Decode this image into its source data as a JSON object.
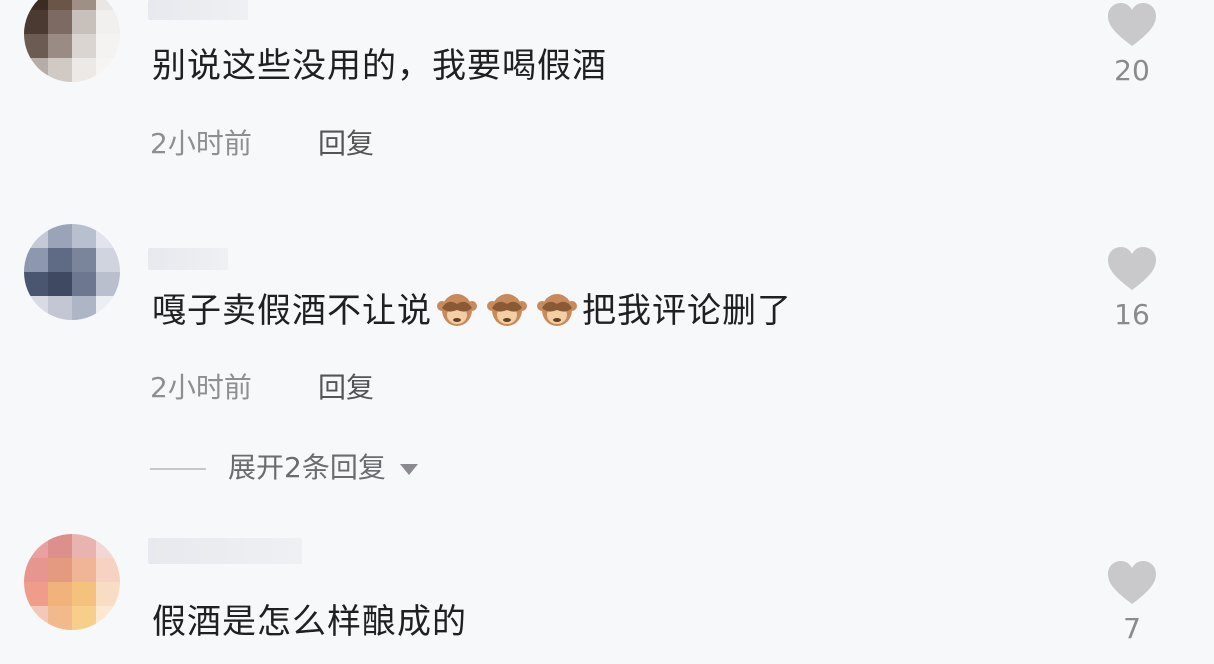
{
  "comments": [
    {
      "text": "别说这些没用的，我要喝假酒",
      "time": "2小时前",
      "reply_label": "回复",
      "likes": "20",
      "avatar_colors": [
        "#3b2b22",
        "#6a5548",
        "#a08f85",
        "#e9e6e3",
        "#4a3a32",
        "#7d6b63",
        "#c7c0bb",
        "#f2f0ee",
        "#6b5b52",
        "#9a8c84",
        "#dbd5d1",
        "#f4f3f2",
        "#b8aca6",
        "#d1c9c4",
        "#ece9e7",
        "#f6f5f4"
      ]
    },
    {
      "text_before": "嘎子卖假酒不让说",
      "text_after": "把我评论删了",
      "emoji": "see-no-evil-monkey",
      "emoji_count": 3,
      "time": "2小时前",
      "reply_label": "回复",
      "likes": "16",
      "expand_label": "展开2条回复",
      "avatar_colors": [
        "#c5c9d6",
        "#9aa3b8",
        "#b8bfcf",
        "#e1e4ec",
        "#8d97ad",
        "#5f6b84",
        "#7a859c",
        "#cfd4df",
        "#4a5670",
        "#3f4a62",
        "#6d7890",
        "#b9bfcd",
        "#d8dbe3",
        "#c2c7d3",
        "#aeb5c5",
        "#eceef2"
      ]
    },
    {
      "text": "假酒是怎么样酿成的",
      "likes": "7",
      "avatar_colors": [
        "#e8a0a0",
        "#dd8f8c",
        "#e9b4b0",
        "#f3d7d5",
        "#e6968f",
        "#e49a7f",
        "#f0b596",
        "#f6d2c2",
        "#ef9d8a",
        "#f2b27c",
        "#f5c27e",
        "#f8dcc4",
        "#f3c8b8",
        "#f1b98c",
        "#f7cf8a",
        "#fbe7d2"
      ]
    }
  ],
  "colors": {
    "background": "#f7f8fa",
    "heart": "#c9c9cc",
    "emoji_face": "#c98a5b"
  }
}
